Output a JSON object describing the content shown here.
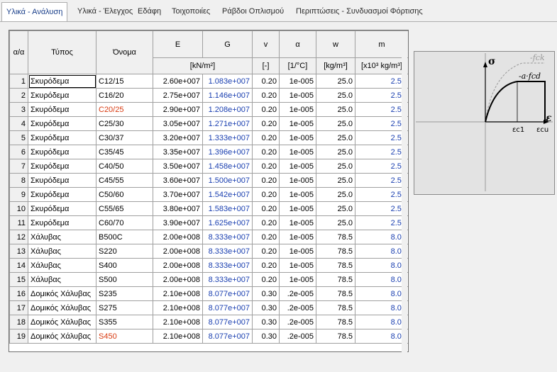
{
  "tabs": [
    {
      "label": "Υλικά - Ανάλυση",
      "active": true
    },
    {
      "label": "Υλικά - Έλεγχος"
    },
    {
      "label": "Εδάφη"
    },
    {
      "label": "Τοιχοποιίες"
    },
    {
      "label": "Ράβδοι Οπλισμού"
    },
    {
      "label": "Περιπτώσεις - Συνδυασμοί Φόρτισης"
    }
  ],
  "table": {
    "headers": {
      "idx": "α/α",
      "type": "Τύπος",
      "name": "Όνομα",
      "E": "E",
      "G": "G",
      "nu": "v",
      "alpha": "α",
      "w": "w",
      "m": "m"
    },
    "units": {
      "EG": "[kN/m²]",
      "nu": "[-]",
      "alpha": "[1/°C]",
      "w": "[kg/m³]",
      "m": "[x10³ kg/m³]"
    },
    "rows": [
      {
        "idx": "1",
        "type": "Σκυρόδεμα",
        "name": "C12/15",
        "E": "2.60e+007",
        "G": "1.083e+007",
        "nu": "0.20",
        "alpha": "1e-005",
        "w": "25.0",
        "m": "2.55"
      },
      {
        "idx": "2",
        "type": "Σκυρόδεμα",
        "name": "C16/20",
        "E": "2.75e+007",
        "G": "1.146e+007",
        "nu": "0.20",
        "alpha": "1e-005",
        "w": "25.0",
        "m": "2.55"
      },
      {
        "idx": "3",
        "type": "Σκυρόδεμα",
        "name": "C20/25",
        "E": "2.90e+007",
        "G": "1.208e+007",
        "nu": "0.20",
        "alpha": "1e-005",
        "w": "25.0",
        "m": "2.55"
      },
      {
        "idx": "4",
        "type": "Σκυρόδεμα",
        "name": "C25/30",
        "E": "3.05e+007",
        "G": "1.271e+007",
        "nu": "0.20",
        "alpha": "1e-005",
        "w": "25.0",
        "m": "2.55"
      },
      {
        "idx": "5",
        "type": "Σκυρόδεμα",
        "name": "C30/37",
        "E": "3.20e+007",
        "G": "1.333e+007",
        "nu": "0.20",
        "alpha": "1e-005",
        "w": "25.0",
        "m": "2.55"
      },
      {
        "idx": "6",
        "type": "Σκυρόδεμα",
        "name": "C35/45",
        "E": "3.35e+007",
        "G": "1.396e+007",
        "nu": "0.20",
        "alpha": "1e-005",
        "w": "25.0",
        "m": "2.55"
      },
      {
        "idx": "7",
        "type": "Σκυρόδεμα",
        "name": "C40/50",
        "E": "3.50e+007",
        "G": "1.458e+007",
        "nu": "0.20",
        "alpha": "1e-005",
        "w": "25.0",
        "m": "2.55"
      },
      {
        "idx": "8",
        "type": "Σκυρόδεμα",
        "name": "C45/55",
        "E": "3.60e+007",
        "G": "1.500e+007",
        "nu": "0.20",
        "alpha": "1e-005",
        "w": "25.0",
        "m": "2.55"
      },
      {
        "idx": "9",
        "type": "Σκυρόδεμα",
        "name": "C50/60",
        "E": "3.70e+007",
        "G": "1.542e+007",
        "nu": "0.20",
        "alpha": "1e-005",
        "w": "25.0",
        "m": "2.55"
      },
      {
        "idx": "10",
        "type": "Σκυρόδεμα",
        "name": "C55/65",
        "E": "3.80e+007",
        "G": "1.583e+007",
        "nu": "0.20",
        "alpha": "1e-005",
        "w": "25.0",
        "m": "2.55"
      },
      {
        "idx": "11",
        "type": "Σκυρόδεμα",
        "name": "C60/70",
        "E": "3.90e+007",
        "G": "1.625e+007",
        "nu": "0.20",
        "alpha": "1e-005",
        "w": "25.0",
        "m": "2.55"
      },
      {
        "idx": "12",
        "type": "Χάλυβας",
        "name": "B500C",
        "E": "2.00e+008",
        "G": "8.333e+007",
        "nu": "0.20",
        "alpha": "1e-005",
        "w": "78.5",
        "m": "8.00"
      },
      {
        "idx": "13",
        "type": "Χάλυβας",
        "name": "S220",
        "E": "2.00e+008",
        "G": "8.333e+007",
        "nu": "0.20",
        "alpha": "1e-005",
        "w": "78.5",
        "m": "8.00"
      },
      {
        "idx": "14",
        "type": "Χάλυβας",
        "name": "S400",
        "E": "2.00e+008",
        "G": "8.333e+007",
        "nu": "0.20",
        "alpha": "1e-005",
        "w": "78.5",
        "m": "8.00"
      },
      {
        "idx": "15",
        "type": "Χάλυβας",
        "name": "S500",
        "E": "2.00e+008",
        "G": "8.333e+007",
        "nu": "0.20",
        "alpha": "1e-005",
        "w": "78.5",
        "m": "8.00"
      },
      {
        "idx": "16",
        "type": "Δομικός Χάλυβας",
        "name": "S235",
        "E": "2.10e+008",
        "G": "8.077e+007",
        "nu": "0.30",
        "alpha": ".2e-005",
        "w": "78.5",
        "m": "8.00"
      },
      {
        "idx": "17",
        "type": "Δομικός Χάλυβας",
        "name": "S275",
        "E": "2.10e+008",
        "G": "8.077e+007",
        "nu": "0.30",
        "alpha": ".2e-005",
        "w": "78.5",
        "m": "8.00"
      },
      {
        "idx": "18",
        "type": "Δομικός Χάλυβας",
        "name": "S355",
        "E": "2.10e+008",
        "G": "8.077e+007",
        "nu": "0.30",
        "alpha": ".2e-005",
        "w": "78.5",
        "m": "8.00"
      },
      {
        "idx": "19",
        "type": "Δομικός Χάλυβας",
        "name": "S450",
        "E": "2.10e+008",
        "G": "8.077e+007",
        "nu": "0.30",
        "alpha": ".2e-005",
        "w": "78.5",
        "m": "8.00"
      }
    ]
  },
  "diagram": {
    "sigma": "σ",
    "epsilon": "ε",
    "fck": "-fck",
    "afcd": "-a·fcd",
    "ec1": "εc1",
    "ecu": "εcu"
  },
  "colors": {
    "blue_value": "#1a3fb0",
    "red_name": "#d83a10"
  },
  "highlight": {
    "red_name_rows": [
      3,
      19
    ],
    "selected_row": 1
  }
}
